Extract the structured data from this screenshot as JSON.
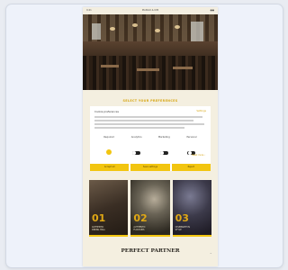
{
  "device": {
    "status_left": "9:41",
    "status_center": "MANGO & KIM",
    "status_right": "●●"
  },
  "section": {
    "title": "SELECT YOUR PREFERENCES"
  },
  "settings": {
    "title": "Cookie preferences",
    "link": "Settings",
    "options": [
      {
        "label": "Required",
        "state": "on"
      },
      {
        "label": "Analytics",
        "state": "off"
      },
      {
        "label": "Marketing",
        "state": "off"
      },
      {
        "label": "Personal",
        "state": "off"
      }
    ],
    "more_link": "Read more ›",
    "buttons": [
      "Accept all",
      "Save settings",
      "Reject"
    ]
  },
  "tiles": [
    {
      "number": "01",
      "caption_line1": "AUTHENTIC",
      "caption_line2": "DINING HALL"
    },
    {
      "number": "02",
      "caption_line1": "AUTHENTIC",
      "caption_line2": "FLAVOURS"
    },
    {
      "number": "03",
      "caption_line1": "CELEBRATE IN",
      "caption_line2": "STYLE"
    }
  ],
  "partner": {
    "title": "PERFECT PARTNER"
  },
  "icons": {
    "scroll_top": "chevron-up-icon"
  },
  "colors": {
    "accent": "#f2c510",
    "gold_text": "#d7a613",
    "page_bg": "#f4efe0"
  }
}
